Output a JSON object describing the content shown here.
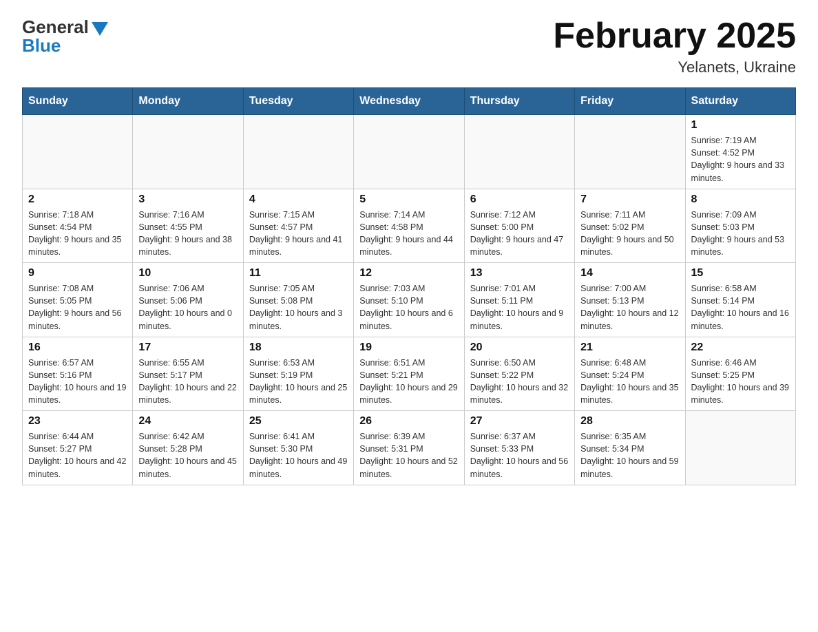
{
  "logo": {
    "general": "General",
    "blue": "Blue"
  },
  "title": "February 2025",
  "subtitle": "Yelanets, Ukraine",
  "weekdays": [
    "Sunday",
    "Monday",
    "Tuesday",
    "Wednesday",
    "Thursday",
    "Friday",
    "Saturday"
  ],
  "weeks": [
    [
      {
        "day": "",
        "info": ""
      },
      {
        "day": "",
        "info": ""
      },
      {
        "day": "",
        "info": ""
      },
      {
        "day": "",
        "info": ""
      },
      {
        "day": "",
        "info": ""
      },
      {
        "day": "",
        "info": ""
      },
      {
        "day": "1",
        "info": "Sunrise: 7:19 AM\nSunset: 4:52 PM\nDaylight: 9 hours and 33 minutes."
      }
    ],
    [
      {
        "day": "2",
        "info": "Sunrise: 7:18 AM\nSunset: 4:54 PM\nDaylight: 9 hours and 35 minutes."
      },
      {
        "day": "3",
        "info": "Sunrise: 7:16 AM\nSunset: 4:55 PM\nDaylight: 9 hours and 38 minutes."
      },
      {
        "day": "4",
        "info": "Sunrise: 7:15 AM\nSunset: 4:57 PM\nDaylight: 9 hours and 41 minutes."
      },
      {
        "day": "5",
        "info": "Sunrise: 7:14 AM\nSunset: 4:58 PM\nDaylight: 9 hours and 44 minutes."
      },
      {
        "day": "6",
        "info": "Sunrise: 7:12 AM\nSunset: 5:00 PM\nDaylight: 9 hours and 47 minutes."
      },
      {
        "day": "7",
        "info": "Sunrise: 7:11 AM\nSunset: 5:02 PM\nDaylight: 9 hours and 50 minutes."
      },
      {
        "day": "8",
        "info": "Sunrise: 7:09 AM\nSunset: 5:03 PM\nDaylight: 9 hours and 53 minutes."
      }
    ],
    [
      {
        "day": "9",
        "info": "Sunrise: 7:08 AM\nSunset: 5:05 PM\nDaylight: 9 hours and 56 minutes."
      },
      {
        "day": "10",
        "info": "Sunrise: 7:06 AM\nSunset: 5:06 PM\nDaylight: 10 hours and 0 minutes."
      },
      {
        "day": "11",
        "info": "Sunrise: 7:05 AM\nSunset: 5:08 PM\nDaylight: 10 hours and 3 minutes."
      },
      {
        "day": "12",
        "info": "Sunrise: 7:03 AM\nSunset: 5:10 PM\nDaylight: 10 hours and 6 minutes."
      },
      {
        "day": "13",
        "info": "Sunrise: 7:01 AM\nSunset: 5:11 PM\nDaylight: 10 hours and 9 minutes."
      },
      {
        "day": "14",
        "info": "Sunrise: 7:00 AM\nSunset: 5:13 PM\nDaylight: 10 hours and 12 minutes."
      },
      {
        "day": "15",
        "info": "Sunrise: 6:58 AM\nSunset: 5:14 PM\nDaylight: 10 hours and 16 minutes."
      }
    ],
    [
      {
        "day": "16",
        "info": "Sunrise: 6:57 AM\nSunset: 5:16 PM\nDaylight: 10 hours and 19 minutes."
      },
      {
        "day": "17",
        "info": "Sunrise: 6:55 AM\nSunset: 5:17 PM\nDaylight: 10 hours and 22 minutes."
      },
      {
        "day": "18",
        "info": "Sunrise: 6:53 AM\nSunset: 5:19 PM\nDaylight: 10 hours and 25 minutes."
      },
      {
        "day": "19",
        "info": "Sunrise: 6:51 AM\nSunset: 5:21 PM\nDaylight: 10 hours and 29 minutes."
      },
      {
        "day": "20",
        "info": "Sunrise: 6:50 AM\nSunset: 5:22 PM\nDaylight: 10 hours and 32 minutes."
      },
      {
        "day": "21",
        "info": "Sunrise: 6:48 AM\nSunset: 5:24 PM\nDaylight: 10 hours and 35 minutes."
      },
      {
        "day": "22",
        "info": "Sunrise: 6:46 AM\nSunset: 5:25 PM\nDaylight: 10 hours and 39 minutes."
      }
    ],
    [
      {
        "day": "23",
        "info": "Sunrise: 6:44 AM\nSunset: 5:27 PM\nDaylight: 10 hours and 42 minutes."
      },
      {
        "day": "24",
        "info": "Sunrise: 6:42 AM\nSunset: 5:28 PM\nDaylight: 10 hours and 45 minutes."
      },
      {
        "day": "25",
        "info": "Sunrise: 6:41 AM\nSunset: 5:30 PM\nDaylight: 10 hours and 49 minutes."
      },
      {
        "day": "26",
        "info": "Sunrise: 6:39 AM\nSunset: 5:31 PM\nDaylight: 10 hours and 52 minutes."
      },
      {
        "day": "27",
        "info": "Sunrise: 6:37 AM\nSunset: 5:33 PM\nDaylight: 10 hours and 56 minutes."
      },
      {
        "day": "28",
        "info": "Sunrise: 6:35 AM\nSunset: 5:34 PM\nDaylight: 10 hours and 59 minutes."
      },
      {
        "day": "",
        "info": ""
      }
    ]
  ]
}
